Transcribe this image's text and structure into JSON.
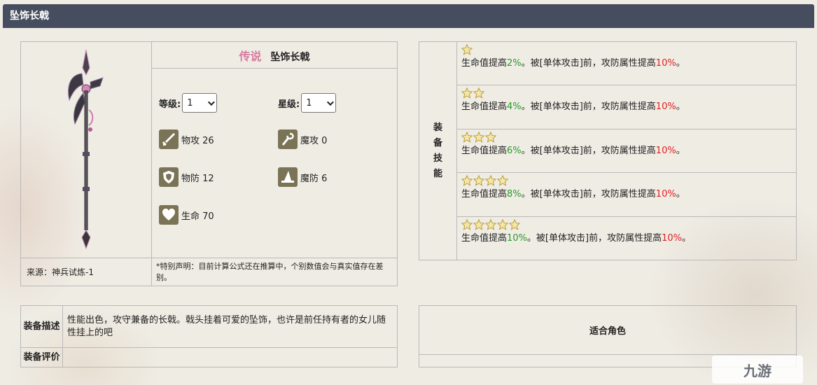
{
  "header": {
    "title": "坠饰长戟"
  },
  "equipment": {
    "rarity": "传说",
    "name": "坠饰长戟",
    "level_label": "等级:",
    "level_value": "1",
    "star_label": "星级:",
    "star_value": "1",
    "stats": [
      {
        "icon": "sword-icon",
        "label": "物攻 26"
      },
      {
        "icon": "wand-icon",
        "label": "魔攻 0"
      },
      {
        "icon": "shield-icon",
        "label": "物防 12"
      },
      {
        "icon": "wizard-hat-icon",
        "label": "魔防 6"
      },
      {
        "icon": "heart-icon",
        "label": "生命 70"
      }
    ],
    "source": "来源：神兵试炼-1",
    "note": "*特别声明：目前计算公式还在推算中，个别数值会与真实值存在差别。"
  },
  "skills": {
    "label": "装备技能",
    "label_chars": [
      "装",
      "备",
      "技",
      "能"
    ],
    "items": [
      {
        "stars": 1,
        "pre": "生命值提高",
        "hp": "2%",
        "mid": "。被[单体攻击]前，攻防属性提高",
        "atk": "10%",
        "end": "。"
      },
      {
        "stars": 2,
        "pre": "生命值提高",
        "hp": "4%",
        "mid": "。被[单体攻击]前，攻防属性提高",
        "atk": "10%",
        "end": "。"
      },
      {
        "stars": 3,
        "pre": "生命值提高",
        "hp": "6%",
        "mid": "。被[单体攻击]前，攻防属性提高",
        "atk": "10%",
        "end": "。"
      },
      {
        "stars": 4,
        "pre": "生命值提高",
        "hp": "8%",
        "mid": "。被[单体攻击]前，攻防属性提高",
        "atk": "10%",
        "end": "。"
      },
      {
        "stars": 5,
        "pre": "生命值提高",
        "hp": "10%",
        "mid": "。被[单体攻击]前，攻防属性提高",
        "atk": "10%",
        "end": "。"
      }
    ],
    "colors": {
      "hp": "#2a9a2a",
      "atk": "#e02020"
    }
  },
  "description": {
    "desc_label": "装备描述",
    "desc_text": "性能出色，攻守兼备的长戟。戟头挂着可爱的坠饰，也许是前任持有者的女儿随性挂上的吧",
    "eval_label": "装备评价",
    "eval_text": ""
  },
  "roles": {
    "title": "适合角色"
  },
  "watermark": {
    "text": "九游"
  }
}
